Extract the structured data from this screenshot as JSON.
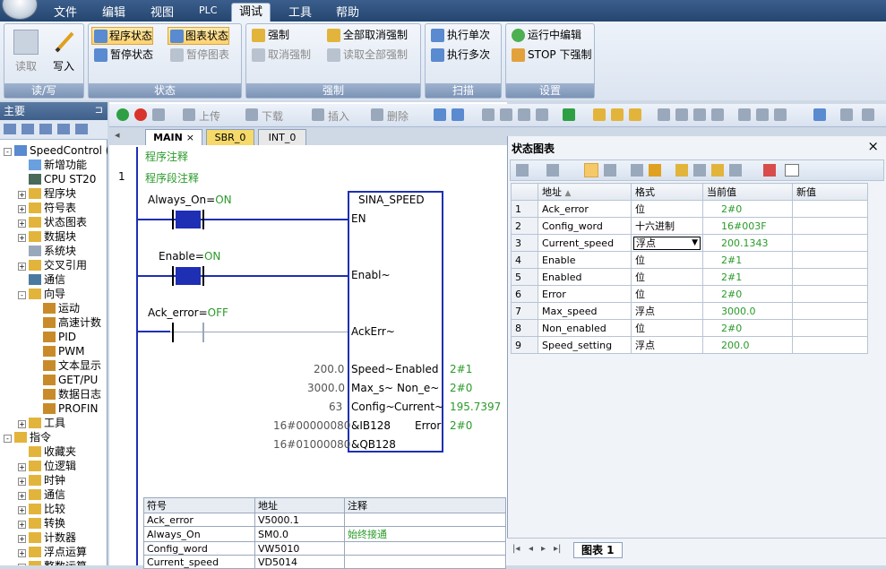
{
  "menu": {
    "items": [
      "文件",
      "编辑",
      "视图",
      "PLC",
      "调试",
      "工具",
      "帮助"
    ],
    "active": "调试"
  },
  "ribbon": {
    "read_write": {
      "read": "读取",
      "write": "写入",
      "label": "读/写"
    },
    "status": {
      "program_status": "程序状态",
      "chart_status": "图表状态",
      "pause_program": "暂停状态",
      "pause_chart": "暂停图表",
      "label": "状态"
    },
    "force": {
      "force": "强制",
      "unforce": "取消强制",
      "unforce_all": "全部取消强制",
      "read_all": "读取全部强制",
      "label": "强制"
    },
    "scan": {
      "single": "执行单次",
      "multi": "执行多次",
      "label": "扫描"
    },
    "settings": {
      "run_edit": "运行中编辑",
      "stop_force": "STOP 下强制",
      "label": "设置"
    }
  },
  "sidebar": {
    "title": "主要",
    "items": [
      "SpeedControl (C",
      "新增功能",
      "CPU ST20",
      "程序块",
      "符号表",
      "状态图表",
      "数据块",
      "系统块",
      "交叉引用",
      "通信",
      "向导",
      "运动",
      "高速计数",
      "PID",
      "PWM",
      "文本显示",
      "GET/PU",
      "数据日志",
      "PROFIN",
      "工具",
      "指令",
      "收藏夹",
      "位逻辑",
      "时钟",
      "通信",
      "比较",
      "转换",
      "计数器",
      "浮点运算",
      "整数运算"
    ]
  },
  "editor": {
    "toolbar": {
      "upload": "上传",
      "download": "下载",
      "insert": "插入",
      "delete": "删除"
    },
    "tabs": [
      "MAIN",
      "SBR_0",
      "INT_0"
    ],
    "program_comment": "程序注释",
    "network_num": "1",
    "network_comment": "程序段注释",
    "block_name": "SINA_SPEED",
    "contacts": [
      {
        "name": "Always_On",
        "state": "ON"
      },
      {
        "name": "Enable",
        "state": "ON"
      },
      {
        "name": "Ack_error",
        "state": "OFF"
      }
    ],
    "pins_left": [
      "EN",
      "Enabl~",
      "AckErr~",
      "Speed~",
      "Max_s~",
      "Config~",
      "&IB128",
      "&QB128"
    ],
    "pins_right": [
      "Enabled",
      "Non_e~",
      "Current~",
      "Error"
    ],
    "left_values": [
      "200.0",
      "3000.0",
      "63",
      "16#00000080",
      "16#01000080"
    ],
    "right_values": [
      "2#1",
      "2#0",
      "195.7397",
      "2#0"
    ],
    "symbol_table": {
      "headers": [
        "符号",
        "地址",
        "注释"
      ],
      "rows": [
        [
          "Ack_error",
          "V5000.1",
          ""
        ],
        [
          "Always_On",
          "SM0.0",
          "始终接通"
        ],
        [
          "Config_word",
          "VW5010",
          ""
        ],
        [
          "Current_speed",
          "VD5014",
          ""
        ]
      ]
    }
  },
  "status_chart": {
    "title": "状态图表",
    "headers": [
      "",
      "地址",
      "格式",
      "当前值",
      "新值"
    ],
    "rows": [
      [
        "1",
        "Ack_error",
        "位",
        "2#0",
        ""
      ],
      [
        "2",
        "Config_word",
        "十六进制",
        "16#003F",
        ""
      ],
      [
        "3",
        "Current_speed",
        "浮点",
        "200.1343",
        ""
      ],
      [
        "4",
        "Enable",
        "位",
        "2#1",
        ""
      ],
      [
        "5",
        "Enabled",
        "位",
        "2#1",
        ""
      ],
      [
        "6",
        "Error",
        "位",
        "2#0",
        ""
      ],
      [
        "7",
        "Max_speed",
        "浮点",
        "3000.0",
        ""
      ],
      [
        "8",
        "Non_enabled",
        "位",
        "2#0",
        ""
      ],
      [
        "9",
        "Speed_setting",
        "浮点",
        "200.0",
        ""
      ]
    ],
    "sheet_tab": "图表 1"
  }
}
